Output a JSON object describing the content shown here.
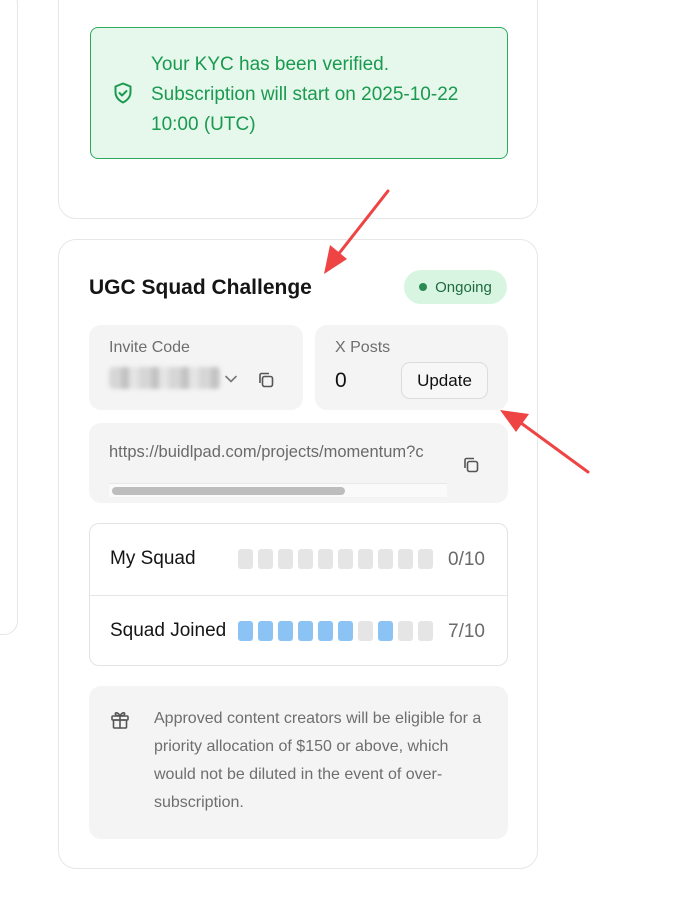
{
  "kyc": {
    "message_line1": "Your KYC has been verified.",
    "message_line2": "Subscription will start on 2025-10-22",
    "message_line3": "10:00 (UTC)",
    "icon": "shield-check-icon"
  },
  "challenge": {
    "title": "UGC Squad Challenge",
    "status": "Ongoing"
  },
  "invite": {
    "label": "Invite Code",
    "code": "",
    "icons": [
      "chevron-down-icon",
      "copy-icon"
    ]
  },
  "xposts": {
    "label": "X Posts",
    "value": "0",
    "update_label": "Update"
  },
  "referral": {
    "url": "https://buidlpad.com/projects/momentum?c",
    "scroll_position": 0.0,
    "scroll_visible_fraction": 0.7
  },
  "squad": {
    "rows": [
      {
        "label": "My Squad",
        "count": "0/10",
        "filled": [
          false,
          false,
          false,
          false,
          false,
          false,
          false,
          false,
          false,
          false
        ]
      },
      {
        "label": "Squad Joined",
        "count": "7/10",
        "filled": [
          true,
          true,
          true,
          true,
          true,
          true,
          false,
          true,
          false,
          false
        ]
      }
    ]
  },
  "note": {
    "text": "Approved content creators will be eligible for a priority allocation of $150 or above, which would not be diluted in the event of over-subscription."
  },
  "colors": {
    "success_green": "#1a9a4f",
    "success_bg": "#e6f7ec",
    "badge_bg": "#d8f5e2",
    "cell_filled": "#8cc3f5",
    "cell_empty": "#e5e5e5",
    "annotation_red": "#ef4444"
  }
}
